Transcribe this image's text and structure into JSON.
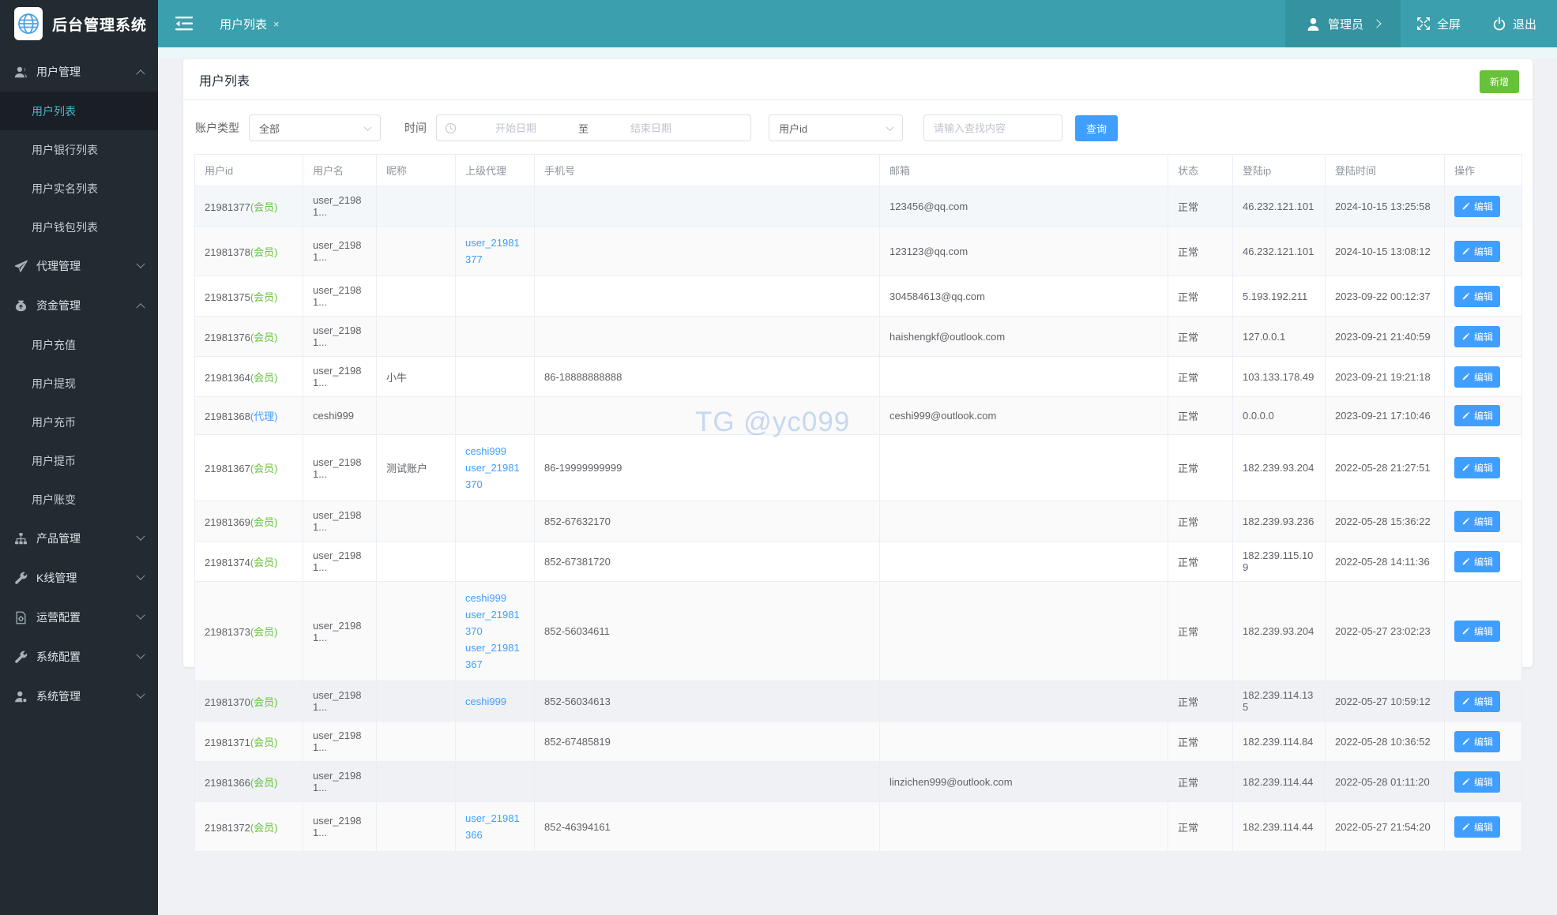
{
  "app": {
    "title": "后台管理系统"
  },
  "topbar": {
    "tab": "用户列表",
    "tab_close": "×",
    "admin": "管理员",
    "fullscreen": "全屏",
    "logout": "退出"
  },
  "sidebar": {
    "menu": [
      {
        "label": "用户管理",
        "icon": "users-icon",
        "state": "expanded",
        "children": [
          {
            "label": "用户列表",
            "active": true
          },
          {
            "label": "用户银行列表"
          },
          {
            "label": "用户实名列表"
          },
          {
            "label": "用户钱包列表"
          }
        ]
      },
      {
        "label": "代理管理",
        "icon": "paper-plane-icon",
        "state": "collapsed",
        "children": []
      },
      {
        "label": "资金管理",
        "icon": "money-bag-icon",
        "state": "expanded",
        "children": [
          {
            "label": "用户充值"
          },
          {
            "label": "用户提现"
          },
          {
            "label": "用户充币"
          },
          {
            "label": "用户提币"
          },
          {
            "label": "用户账变"
          }
        ]
      },
      {
        "label": "产品管理",
        "icon": "sitemap-icon",
        "state": "collapsed",
        "children": []
      },
      {
        "label": "K线管理",
        "icon": "wrench-icon",
        "state": "collapsed",
        "children": []
      },
      {
        "label": "运营配置",
        "icon": "document-gear-icon",
        "state": "collapsed",
        "children": []
      },
      {
        "label": "系统配置",
        "icon": "wrench-icon",
        "state": "collapsed",
        "children": []
      },
      {
        "label": "系统管理",
        "icon": "user-settings-icon",
        "state": "collapsed",
        "children": []
      }
    ]
  },
  "page": {
    "title": "用户列表",
    "add_button": "新增"
  },
  "filters": {
    "account_type_label": "账户类型",
    "account_type_value": "全部",
    "time_label": "时间",
    "start_placeholder": "开始日期",
    "range_separator": "至",
    "end_placeholder": "结束日期",
    "field_value": "用户id",
    "search_placeholder": "请输入查找内容",
    "query_button": "查询"
  },
  "table": {
    "headers": [
      "用户id",
      "用户名",
      "昵称",
      "上级代理",
      "手机号",
      "邮箱",
      "状态",
      "登陆ip",
      "登陆时间",
      "操作"
    ],
    "edit_label": "编辑",
    "rows": [
      {
        "id": "21981377",
        "tag": "(会员)",
        "tag_kind": "member",
        "highlighted": true,
        "username": "user_21981...",
        "nickname": "",
        "agents": [],
        "phone": "",
        "email": "123456@qq.com",
        "status": "正常",
        "ip": "46.232.121.101",
        "time": "2024-10-15 13:25:58"
      },
      {
        "id": "21981378",
        "tag": "(会员)",
        "tag_kind": "member",
        "username": "user_21981...",
        "nickname": "",
        "agents": [
          "user_21981377"
        ],
        "phone": "",
        "email": "123123@qq.com",
        "status": "正常",
        "ip": "46.232.121.101",
        "time": "2024-10-15 13:08:12"
      },
      {
        "id": "21981375",
        "tag": "(会员)",
        "tag_kind": "member",
        "username": "user_21981...",
        "nickname": "",
        "agents": [],
        "phone": "",
        "email": "304584613@qq.com",
        "status": "正常",
        "ip": "5.193.192.211",
        "time": "2023-09-22 00:12:37"
      },
      {
        "id": "21981376",
        "tag": "(会员)",
        "tag_kind": "member",
        "username": "user_21981...",
        "nickname": "",
        "agents": [],
        "phone": "",
        "email": "haishengkf@outlook.com",
        "status": "正常",
        "ip": "127.0.0.1",
        "time": "2023-09-21 21:40:59"
      },
      {
        "id": "21981364",
        "tag": "(会员)",
        "tag_kind": "member",
        "username": "user_21981...",
        "nickname": "小牛",
        "agents": [],
        "phone": "86-18888888888",
        "email": "",
        "status": "正常",
        "ip": "103.133.178.49",
        "time": "2023-09-21 19:21:18"
      },
      {
        "id": "21981368",
        "tag": "(代理)",
        "tag_kind": "agent",
        "username": "ceshi999",
        "nickname": "",
        "agents": [],
        "phone": "",
        "email": "ceshi999@outlook.com",
        "status": "正常",
        "ip": "0.0.0.0",
        "time": "2023-09-21 17:10:46"
      },
      {
        "id": "21981367",
        "tag": "(会员)",
        "tag_kind": "member",
        "username": "user_21981...",
        "nickname": "测试账户",
        "agents": [
          "ceshi999",
          "user_21981370"
        ],
        "phone": "86-19999999999",
        "email": "",
        "status": "正常",
        "ip": "182.239.93.204",
        "time": "2022-05-28 21:27:51"
      },
      {
        "id": "21981369",
        "tag": "(会员)",
        "tag_kind": "member",
        "username": "user_21981...",
        "nickname": "",
        "agents": [],
        "phone": "852-67632170",
        "email": "",
        "status": "正常",
        "ip": "182.239.93.236",
        "time": "2022-05-28 15:36:22"
      },
      {
        "id": "21981374",
        "tag": "(会员)",
        "tag_kind": "member",
        "username": "user_21981...",
        "nickname": "",
        "agents": [],
        "phone": "852-67381720",
        "email": "",
        "status": "正常",
        "ip": "182.239.115.109",
        "time": "2022-05-28 14:11:36"
      },
      {
        "id": "21981373",
        "tag": "(会员)",
        "tag_kind": "member",
        "username": "user_21981...",
        "nickname": "",
        "agents": [
          "ceshi999",
          "user_21981370",
          "user_21981367"
        ],
        "phone": "852-56034611",
        "email": "",
        "status": "正常",
        "ip": "182.239.93.204",
        "time": "2022-05-27 23:02:23"
      },
      {
        "id": "21981370",
        "tag": "(会员)",
        "tag_kind": "member",
        "username": "user_21981...",
        "nickname": "",
        "agents": [
          "ceshi999"
        ],
        "phone": "852-56034613",
        "email": "",
        "status": "正常",
        "ip": "182.239.114.135",
        "time": "2022-05-27 10:59:12"
      },
      {
        "id": "21981371",
        "tag": "(会员)",
        "tag_kind": "member",
        "username": "user_21981...",
        "nickname": "",
        "agents": [],
        "phone": "852-67485819",
        "email": "",
        "status": "正常",
        "ip": "182.239.114.84",
        "time": "2022-05-28 10:36:52"
      },
      {
        "id": "21981366",
        "tag": "(会员)",
        "tag_kind": "member",
        "username": "user_21981...",
        "nickname": "",
        "agents": [],
        "phone": "",
        "email": "linzichen999@outlook.com",
        "status": "正常",
        "ip": "182.239.114.44",
        "time": "2022-05-28 01:11:20"
      },
      {
        "id": "21981372",
        "tag": "(会员)",
        "tag_kind": "member",
        "username": "user_21981...",
        "nickname": "",
        "agents": [
          "user_21981366"
        ],
        "phone": "852-46394161",
        "email": "",
        "status": "正常",
        "ip": "182.239.114.44",
        "time": "2022-05-27 21:54:20"
      }
    ]
  },
  "watermark": {
    "text": "TG @yc099"
  },
  "colors": {
    "topbar_teal": "#3b9fae",
    "sidebar_dark": "#222b31",
    "accent_blue": "#409eff",
    "success_green": "#67c23a",
    "watermark_blue": "rgba(96,150,220,0.34)"
  }
}
